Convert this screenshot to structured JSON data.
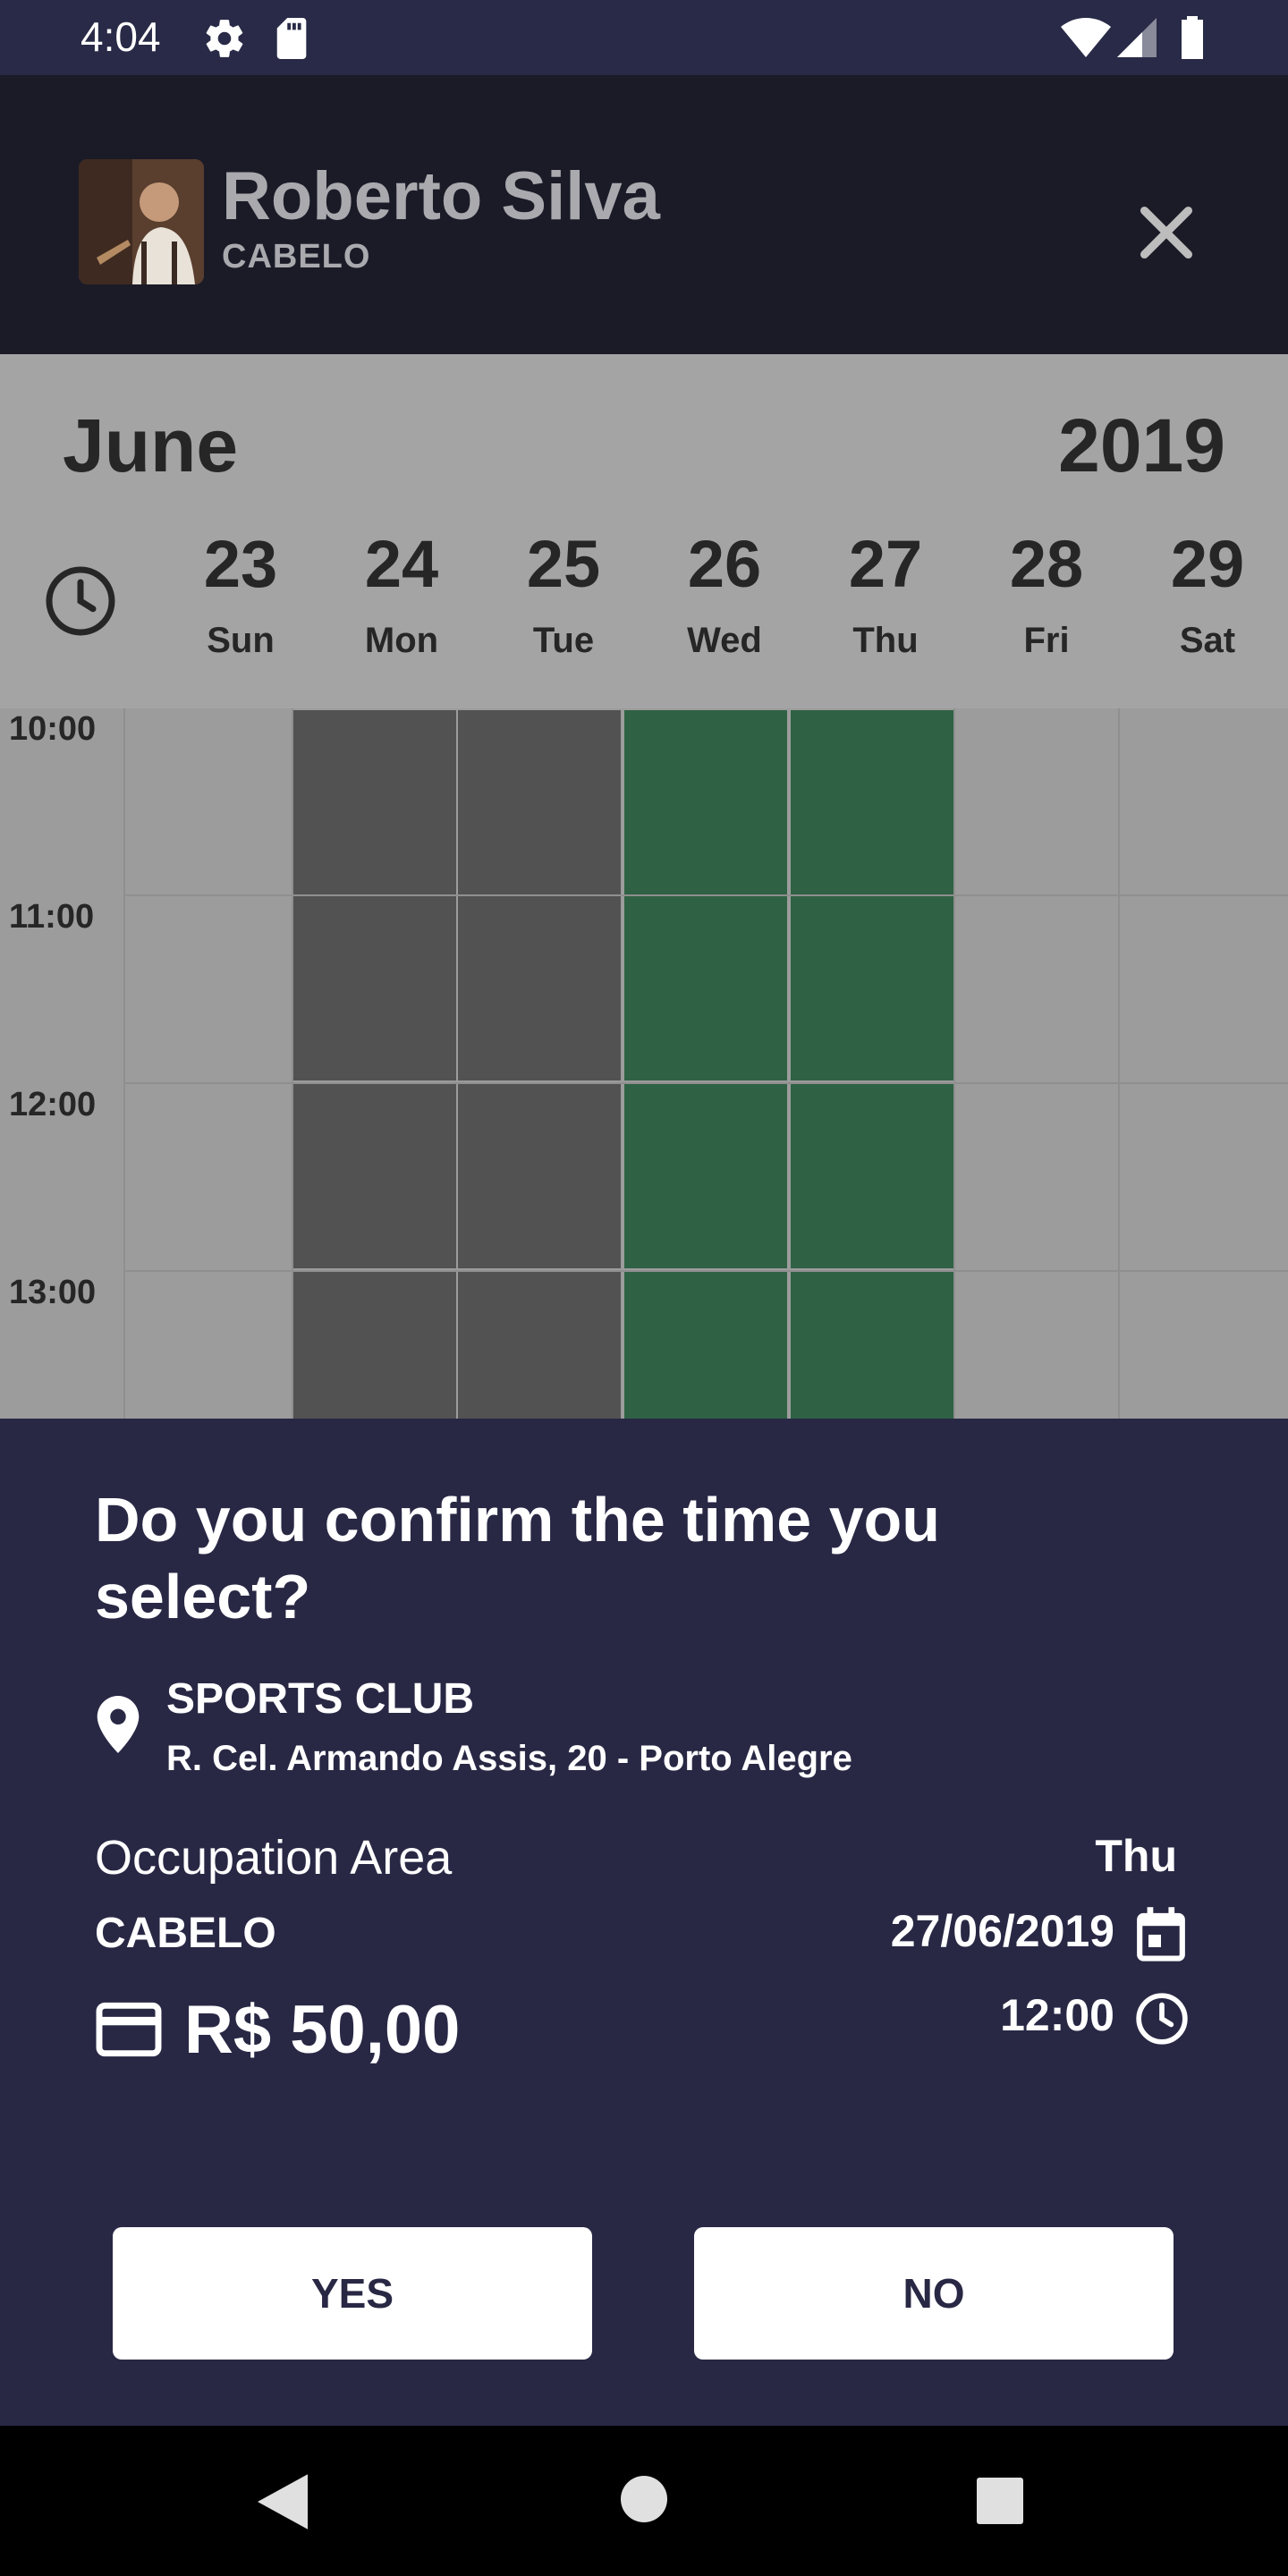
{
  "status_bar": {
    "time": "4:04",
    "icons": [
      "gear-icon",
      "sd-card-icon",
      "wifi-icon",
      "signal-icon",
      "battery-icon"
    ]
  },
  "header": {
    "name": "Roberto Silva",
    "category": "CABELO",
    "close_icon": "close-icon"
  },
  "calendar": {
    "month": "June",
    "year": "2019",
    "days": [
      {
        "num": "23",
        "name": "Sun"
      },
      {
        "num": "24",
        "name": "Mon"
      },
      {
        "num": "25",
        "name": "Tue"
      },
      {
        "num": "26",
        "name": "Wed"
      },
      {
        "num": "27",
        "name": "Thu"
      },
      {
        "num": "28",
        "name": "Fri"
      },
      {
        "num": "29",
        "name": "Sat"
      }
    ],
    "hours": [
      "10:00",
      "11:00",
      "12:00",
      "13:00"
    ],
    "slot_colors": {
      "busy": "#525252",
      "free": "#2f6244"
    }
  },
  "confirm": {
    "title": "Do you confirm the time you select?",
    "place_name": "SPORTS CLUB",
    "place_address": "R. Cel. Armando Assis, 20 - Porto Alegre",
    "area_label": "Occupation Area",
    "area_value": "CABELO",
    "price": "R$ 50,00",
    "weekday": "Thu",
    "date": "27/06/2019",
    "time": "12:00",
    "yes_label": "YES",
    "no_label": "NO"
  },
  "colors": {
    "sheet_bg": "#282845",
    "header_bg": "#1b1b28",
    "status_bg": "#282a47"
  }
}
